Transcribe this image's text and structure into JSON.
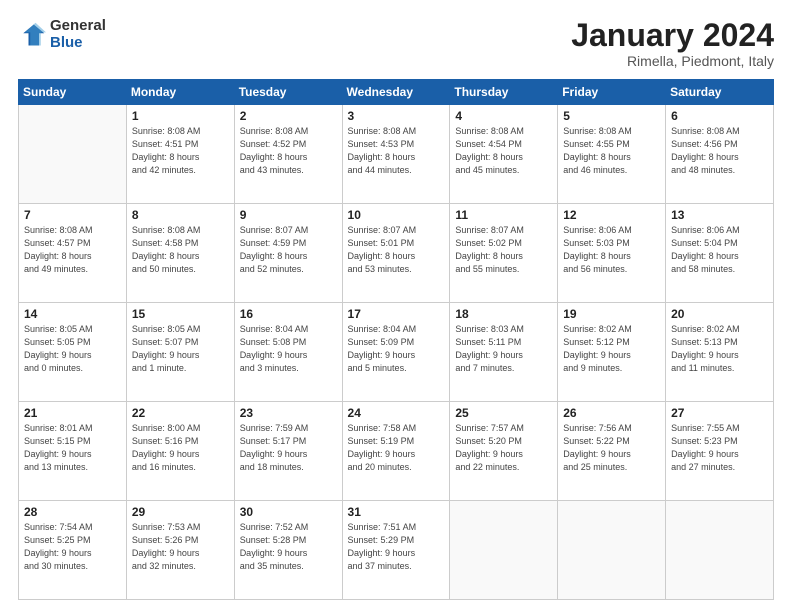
{
  "header": {
    "logo_general": "General",
    "logo_blue": "Blue",
    "month_title": "January 2024",
    "subtitle": "Rimella, Piedmont, Italy"
  },
  "days_of_week": [
    "Sunday",
    "Monday",
    "Tuesday",
    "Wednesday",
    "Thursday",
    "Friday",
    "Saturday"
  ],
  "weeks": [
    [
      {
        "day": "",
        "info": ""
      },
      {
        "day": "1",
        "info": "Sunrise: 8:08 AM\nSunset: 4:51 PM\nDaylight: 8 hours\nand 42 minutes."
      },
      {
        "day": "2",
        "info": "Sunrise: 8:08 AM\nSunset: 4:52 PM\nDaylight: 8 hours\nand 43 minutes."
      },
      {
        "day": "3",
        "info": "Sunrise: 8:08 AM\nSunset: 4:53 PM\nDaylight: 8 hours\nand 44 minutes."
      },
      {
        "day": "4",
        "info": "Sunrise: 8:08 AM\nSunset: 4:54 PM\nDaylight: 8 hours\nand 45 minutes."
      },
      {
        "day": "5",
        "info": "Sunrise: 8:08 AM\nSunset: 4:55 PM\nDaylight: 8 hours\nand 46 minutes."
      },
      {
        "day": "6",
        "info": "Sunrise: 8:08 AM\nSunset: 4:56 PM\nDaylight: 8 hours\nand 48 minutes."
      }
    ],
    [
      {
        "day": "7",
        "info": "Sunrise: 8:08 AM\nSunset: 4:57 PM\nDaylight: 8 hours\nand 49 minutes."
      },
      {
        "day": "8",
        "info": "Sunrise: 8:08 AM\nSunset: 4:58 PM\nDaylight: 8 hours\nand 50 minutes."
      },
      {
        "day": "9",
        "info": "Sunrise: 8:07 AM\nSunset: 4:59 PM\nDaylight: 8 hours\nand 52 minutes."
      },
      {
        "day": "10",
        "info": "Sunrise: 8:07 AM\nSunset: 5:01 PM\nDaylight: 8 hours\nand 53 minutes."
      },
      {
        "day": "11",
        "info": "Sunrise: 8:07 AM\nSunset: 5:02 PM\nDaylight: 8 hours\nand 55 minutes."
      },
      {
        "day": "12",
        "info": "Sunrise: 8:06 AM\nSunset: 5:03 PM\nDaylight: 8 hours\nand 56 minutes."
      },
      {
        "day": "13",
        "info": "Sunrise: 8:06 AM\nSunset: 5:04 PM\nDaylight: 8 hours\nand 58 minutes."
      }
    ],
    [
      {
        "day": "14",
        "info": "Sunrise: 8:05 AM\nSunset: 5:05 PM\nDaylight: 9 hours\nand 0 minutes."
      },
      {
        "day": "15",
        "info": "Sunrise: 8:05 AM\nSunset: 5:07 PM\nDaylight: 9 hours\nand 1 minute."
      },
      {
        "day": "16",
        "info": "Sunrise: 8:04 AM\nSunset: 5:08 PM\nDaylight: 9 hours\nand 3 minutes."
      },
      {
        "day": "17",
        "info": "Sunrise: 8:04 AM\nSunset: 5:09 PM\nDaylight: 9 hours\nand 5 minutes."
      },
      {
        "day": "18",
        "info": "Sunrise: 8:03 AM\nSunset: 5:11 PM\nDaylight: 9 hours\nand 7 minutes."
      },
      {
        "day": "19",
        "info": "Sunrise: 8:02 AM\nSunset: 5:12 PM\nDaylight: 9 hours\nand 9 minutes."
      },
      {
        "day": "20",
        "info": "Sunrise: 8:02 AM\nSunset: 5:13 PM\nDaylight: 9 hours\nand 11 minutes."
      }
    ],
    [
      {
        "day": "21",
        "info": "Sunrise: 8:01 AM\nSunset: 5:15 PM\nDaylight: 9 hours\nand 13 minutes."
      },
      {
        "day": "22",
        "info": "Sunrise: 8:00 AM\nSunset: 5:16 PM\nDaylight: 9 hours\nand 16 minutes."
      },
      {
        "day": "23",
        "info": "Sunrise: 7:59 AM\nSunset: 5:17 PM\nDaylight: 9 hours\nand 18 minutes."
      },
      {
        "day": "24",
        "info": "Sunrise: 7:58 AM\nSunset: 5:19 PM\nDaylight: 9 hours\nand 20 minutes."
      },
      {
        "day": "25",
        "info": "Sunrise: 7:57 AM\nSunset: 5:20 PM\nDaylight: 9 hours\nand 22 minutes."
      },
      {
        "day": "26",
        "info": "Sunrise: 7:56 AM\nSunset: 5:22 PM\nDaylight: 9 hours\nand 25 minutes."
      },
      {
        "day": "27",
        "info": "Sunrise: 7:55 AM\nSunset: 5:23 PM\nDaylight: 9 hours\nand 27 minutes."
      }
    ],
    [
      {
        "day": "28",
        "info": "Sunrise: 7:54 AM\nSunset: 5:25 PM\nDaylight: 9 hours\nand 30 minutes."
      },
      {
        "day": "29",
        "info": "Sunrise: 7:53 AM\nSunset: 5:26 PM\nDaylight: 9 hours\nand 32 minutes."
      },
      {
        "day": "30",
        "info": "Sunrise: 7:52 AM\nSunset: 5:28 PM\nDaylight: 9 hours\nand 35 minutes."
      },
      {
        "day": "31",
        "info": "Sunrise: 7:51 AM\nSunset: 5:29 PM\nDaylight: 9 hours\nand 37 minutes."
      },
      {
        "day": "",
        "info": ""
      },
      {
        "day": "",
        "info": ""
      },
      {
        "day": "",
        "info": ""
      }
    ]
  ]
}
